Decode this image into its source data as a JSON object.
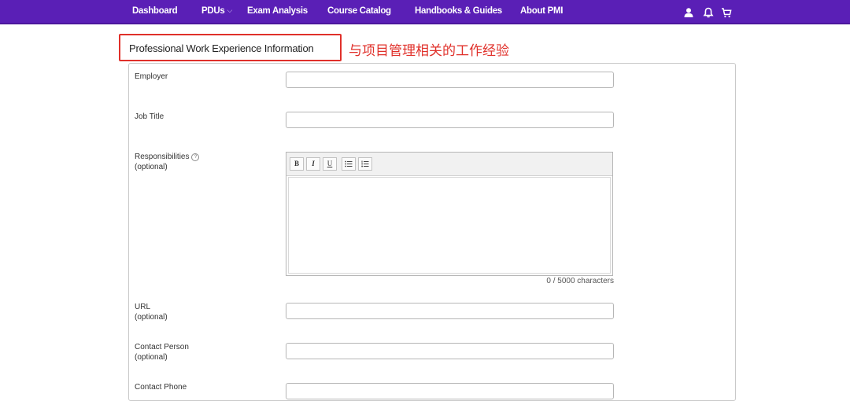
{
  "nav": {
    "items": [
      "Dashboard",
      "PDUs",
      "Exam Analysis",
      "Course Catalog",
      "Handbooks & Guides",
      "About PMI"
    ],
    "pdus_caret": "⌵",
    "icons": [
      "user-icon",
      "bell-icon",
      "cart-icon"
    ],
    "bg_color": "#5a1fb6"
  },
  "section": {
    "title": "Professional Work Experience Information",
    "annotation": "与项目管理相关的工作经验",
    "highlight_color": "#e0302a"
  },
  "form": {
    "employer_label": "Employer",
    "job_title_label": "Job Title",
    "responsibilities_label": "Responsibilities",
    "responsibilities_optional": "(optional)",
    "url_label": "URL",
    "url_optional": "(optional)",
    "contact_person_label": "Contact Person",
    "contact_person_optional": "(optional)",
    "contact_phone_label": "Contact Phone",
    "employer_value": "",
    "job_title_value": "",
    "url_value": "",
    "contact_person_value": "",
    "contact_phone_value": "",
    "char_count": "0 / 5000 characters",
    "toolbar": {
      "bold": "B",
      "italic": "I",
      "underline": "U",
      "bullet_list": "☰",
      "numbered_list": "⁝☰"
    }
  }
}
